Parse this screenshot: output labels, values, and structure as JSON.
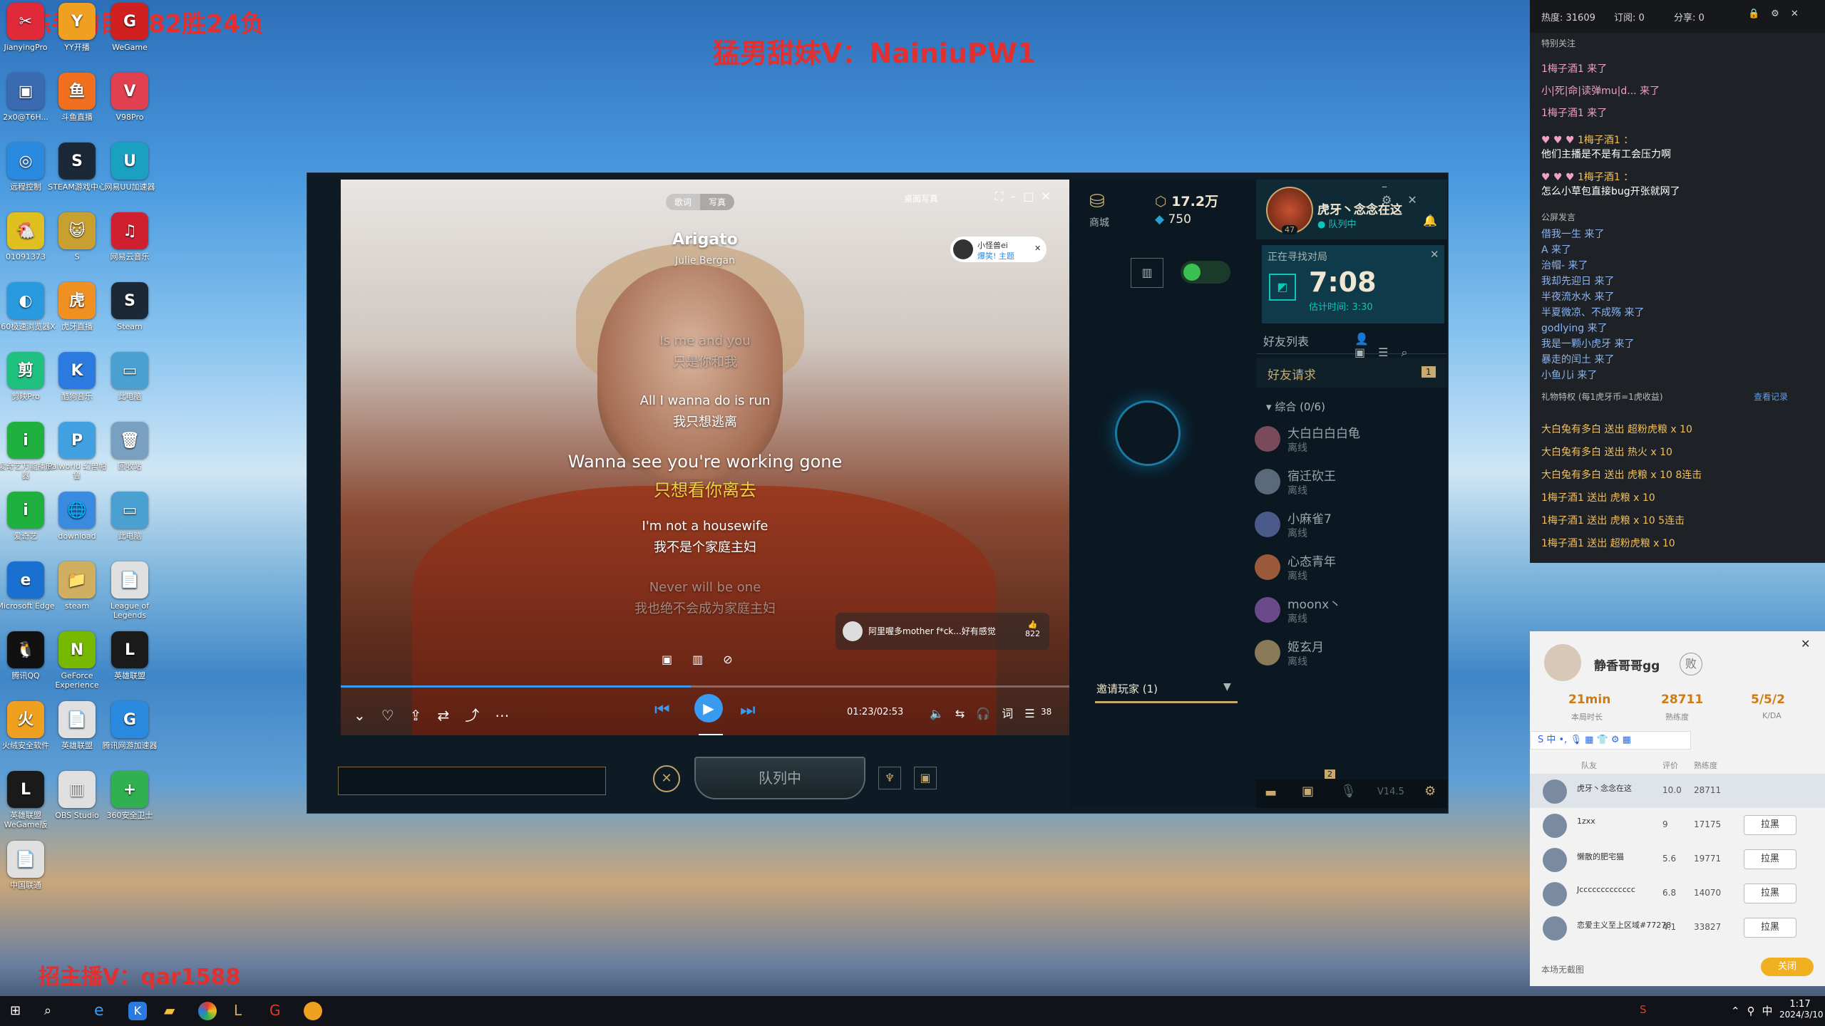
{
  "overlays": {
    "top_left": "炼手豹目前82胜24负",
    "top_center": "猛男甜妹V：NainiuPW1",
    "bottom_left": "招主播V：qar1588"
  },
  "desktop_icons": [
    {
      "label": "JianyingPro",
      "color": "#e02a3a",
      "glyph": "✂"
    },
    {
      "label": "YY开播",
      "color": "#f0a020",
      "glyph": "Y"
    },
    {
      "label": "WeGame",
      "color": "#d02020",
      "glyph": "G"
    },
    {
      "label": "2x0@T6H...",
      "color": "#3a6ab0",
      "glyph": "▣"
    },
    {
      "label": "斗鱼直播",
      "color": "#f07020",
      "glyph": "鱼"
    },
    {
      "label": "V98Pro",
      "color": "#e04050",
      "glyph": "V"
    },
    {
      "label": "远程控制",
      "color": "#2a8ae0",
      "glyph": "◎"
    },
    {
      "label": "STEAM游戏中心",
      "color": "#1b2838",
      "glyph": "S"
    },
    {
      "label": "网易UU加速器",
      "color": "#1aa0c0",
      "glyph": "U"
    },
    {
      "label": "01091373",
      "color": "#e0c020",
      "glyph": "🐔"
    },
    {
      "label": "S",
      "color": "#c8a030",
      "glyph": "😺"
    },
    {
      "label": "网易云音乐",
      "color": "#d02030",
      "glyph": "♫"
    },
    {
      "label": "360极速浏览器X",
      "color": "#2a9ae0",
      "glyph": "◐"
    },
    {
      "label": "虎牙直播",
      "color": "#f09020",
      "glyph": "虎"
    },
    {
      "label": "Steam",
      "color": "#1b2838",
      "glyph": "S"
    },
    {
      "label": "剪映Pro",
      "color": "#20c080",
      "glyph": "剪"
    },
    {
      "label": "酷狗音乐",
      "color": "#2a7ae0",
      "glyph": "K"
    },
    {
      "label": "此电脑",
      "color": "#4aa0d0",
      "glyph": "▭"
    },
    {
      "label": "爱奇艺万能播放器",
      "color": "#20b040",
      "glyph": "i"
    },
    {
      "label": "Palworld 幻兽帕鲁",
      "color": "#40a0e0",
      "glyph": "P"
    },
    {
      "label": "回收站",
      "color": "#7aa0c0",
      "glyph": "🗑"
    },
    {
      "label": "爱奇艺",
      "color": "#20b040",
      "glyph": "i"
    },
    {
      "label": "download",
      "color": "#3a8ae0",
      "glyph": "🌐"
    },
    {
      "label": "此电脑",
      "color": "#4aa0d0",
      "glyph": "▭"
    },
    {
      "label": "Microsoft Edge",
      "color": "#1a70d0",
      "glyph": "e"
    },
    {
      "label": "steam",
      "color": "#d0b060",
      "glyph": "📁"
    },
    {
      "label": "League of Legends",
      "color": "#e0e0e0",
      "glyph": "📄"
    },
    {
      "label": "腾讯QQ",
      "color": "#111111",
      "glyph": "🐧"
    },
    {
      "label": "GeForce Experience",
      "color": "#76b900",
      "glyph": "N"
    },
    {
      "label": "英雄联盟",
      "color": "#1a1a1a",
      "glyph": "L"
    },
    {
      "label": "火绒安全软件",
      "color": "#f0a020",
      "glyph": "火"
    },
    {
      "label": "英雄联盟",
      "color": "#e0e0e0",
      "glyph": "📄"
    },
    {
      "label": "腾讯网游加速器",
      "color": "#2a8ae0",
      "glyph": "G"
    },
    {
      "label": "英雄联盟WeGame版",
      "color": "#1a1a1a",
      "glyph": "L"
    },
    {
      "label": "OBS Studio",
      "color": "#e0e0e0",
      "glyph": "▥"
    },
    {
      "label": "360安全卫士",
      "color": "#30b050",
      "glyph": "+"
    },
    {
      "label": "中国联通",
      "color": "#e0e0e0",
      "glyph": "📄"
    }
  ],
  "music": {
    "tabs": [
      "歌词",
      "写真"
    ],
    "toolbar_right": "桌面写真",
    "title": "Arigato",
    "artist": "Julie Bergan",
    "user_tag": "小怪兽ei",
    "user_tag_sub": "爆笑! 主题",
    "lyrics": [
      {
        "en": "Is me and you",
        "zh": "只是你和我",
        "dim": true
      },
      {
        "en": "All I wanna do is run",
        "zh": "我只想逃离",
        "dim": false
      },
      {
        "en": "Wanna see you're working gone",
        "zh": "只想看你离去",
        "dim": false,
        "current": true
      },
      {
        "en": "I'm not a housewife",
        "zh": "我不是个家庭主妇",
        "dim": false
      },
      {
        "en": "Never will be one",
        "zh": "我也绝不会成为家庭主妇",
        "dim": true
      }
    ],
    "comment": "阿里喔多mother f*ck...好有感觉",
    "likes": "822",
    "time": "01:23/02:53",
    "play_tooltip": "播放",
    "playlist_count": "38"
  },
  "lol": {
    "store_label": "商城",
    "rp": "17.2万",
    "be": "750",
    "summoner_name": "虎牙丶念念在这",
    "summoner_level": "47",
    "summoner_status": "队列中",
    "queue_title": "正在寻找对局",
    "queue_time": "7:08",
    "queue_estimate": "估计时间: 3:30",
    "friends_list_label": "好友列表",
    "friend_requests_label": "好友请求",
    "friend_requests_count": "1",
    "group_label": "综合 (0/6)",
    "friends": [
      {
        "name": "大白白白白龟",
        "status": "离线",
        "color": "#7a4a5a"
      },
      {
        "name": "宿迁砍王",
        "status": "离线",
        "color": "#5a6a7a"
      },
      {
        "name": "小麻雀7",
        "status": "离线",
        "color": "#4a5a8a"
      },
      {
        "name": "心态青年",
        "status": "离线",
        "color": "#9a5a3a"
      },
      {
        "name": "moonx丶",
        "status": "离线",
        "color": "#6a4a8a"
      },
      {
        "name": "姬玄月",
        "status": "离线",
        "color": "#8a7a5a"
      }
    ],
    "invite_label": "邀请玩家 (1)",
    "in_queue_button": "队列中",
    "version": "V14.5",
    "notif_count": "2"
  },
  "chat": {
    "stats": {
      "hot": "热度: 31609",
      "sub": "订阅: 0",
      "share": "分享: 0"
    },
    "special_follow": "特别关注",
    "special_lines": [
      "1梅子酒1 来了",
      "小|死|命|读弹mu|d... 来了",
      "1梅子酒1 来了"
    ],
    "msg1_user": "1梅子酒1 ：",
    "msg1_text": "他们主播是不是有工会压力啊",
    "msg2_user": "1梅子酒1 ：",
    "msg2_text": "怎么小草包直接bug开张就网了",
    "public_label": "公屏发言",
    "public_lines": [
      "借我一生 来了",
      "A 来了",
      "治帽- 来了",
      "我却先迎日 来了",
      "半夜流水水 来了",
      "半夏微凉、不成殇 来了",
      "godlying 来了",
      "我是一颗小虎牙 来了",
      "暴走的闰土 来了",
      "小鱼儿i 来了"
    ],
    "gift_label": "礼物特权 (每1虎牙币=1虎收益)",
    "gift_link": "查看记录",
    "gift_lines": [
      "大白兔有多白 送出 超粉虎粮 x 10",
      "大白兔有多白 送出 热火 x 10",
      "大白兔有多白 送出 虎粮 x 10 8连击",
      "1梅子酒1 送出 虎粮 x 10",
      "1梅子酒1 送出 虎粮 x 10 5连击",
      "1梅子酒1 送出 超粉虎粮 x 10"
    ]
  },
  "stats_panel": {
    "player_name": "静香哥哥gg",
    "badge": "败",
    "time": "21min",
    "time_label": "本局时长",
    "score": "28711",
    "score_label": "熟练度",
    "kda": "5/5/2",
    "kda_label": "K/DA",
    "col_team": "队友",
    "col_rating": "评价",
    "col_skill": "熟练度",
    "rows": [
      {
        "name": "虎牙丶念念在这",
        "rating": "10.0",
        "skill": "28711",
        "btn": ""
      },
      {
        "name": "1zxx",
        "rating": "9",
        "skill": "17175",
        "btn": "拉黑"
      },
      {
        "name": "懒散的肥宅猫",
        "rating": "5.6",
        "skill": "19771",
        "btn": "拉黑"
      },
      {
        "name": "Jccccccccccccc",
        "rating": "6.8",
        "skill": "14070",
        "btn": "拉黑"
      },
      {
        "name": "恋爱主义至上区域#77278",
        "rating": "4.1",
        "skill": "33827",
        "btn": "拉黑"
      }
    ],
    "no_screenshot": "本场无截图",
    "close_btn": "关闭"
  },
  "taskbar": {
    "time": "1:17",
    "date": "2024/3/10"
  }
}
